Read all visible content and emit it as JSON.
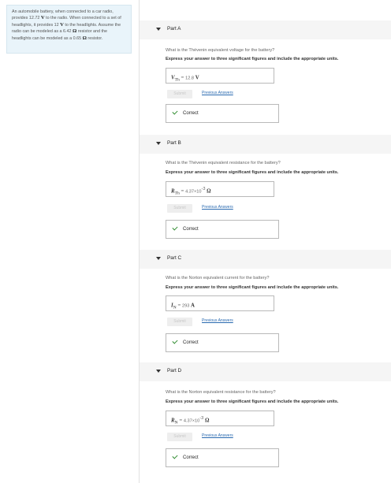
{
  "problem": {
    "text_1": "An automobile battery, when connected to a car radio, provides 12.72",
    "v1_unit": "V",
    "text_2": "to the radio. When connected to a set of headlights, it provides 12",
    "v2_unit": "V",
    "text_3": "to the headlights. Assume the radio can be modeled as a 6.42",
    "r1_unit": "Ω",
    "text_4": "resistor and the headlights can be modeled as a 0.65",
    "r2_unit": "Ω",
    "text_5": "resistor."
  },
  "parts": [
    {
      "title": "Part A",
      "question": "What is the Thévenin equivalent voltage for the battery?",
      "instruction": "Express your answer to three significant figures and include the appropriate units.",
      "variable": "V",
      "variable_sub": "Th",
      "equals": "=",
      "value": "12.8",
      "value_exp": "",
      "unit": "V",
      "submit_label": "Submit",
      "previous_answers_label": "Previous Answers",
      "status": "Correct"
    },
    {
      "title": "Part B",
      "question": "What is the Thévenin equivalent resistance for the battery?",
      "instruction": "Express your answer to three significant figures and include the appropriate units.",
      "variable": "R",
      "variable_sub": "Th",
      "equals": "=",
      "value": "4.37×10",
      "value_exp": "-3",
      "unit": "Ω",
      "submit_label": "Submit",
      "previous_answers_label": "Previous Answers",
      "status": "Correct"
    },
    {
      "title": "Part C",
      "question": "What is the Norton equivalent current for the battery?",
      "instruction": "Express your answer to three significant figures and include the appropriate units.",
      "variable": "I",
      "variable_sub": "N",
      "equals": "=",
      "value": "293",
      "value_exp": "",
      "unit": "A",
      "submit_label": "Submit",
      "previous_answers_label": "Previous Answers",
      "status": "Correct"
    },
    {
      "title": "Part D",
      "question": "What is the Norton equivalent resistance for the battery?",
      "instruction": "Express your answer to three significant figures and include the appropriate units.",
      "variable": "R",
      "variable_sub": "N",
      "equals": "=",
      "value": "4.37×10",
      "value_exp": "-3",
      "unit": "Ω",
      "submit_label": "Submit",
      "previous_answers_label": "Previous Answers",
      "status": "Correct"
    }
  ]
}
